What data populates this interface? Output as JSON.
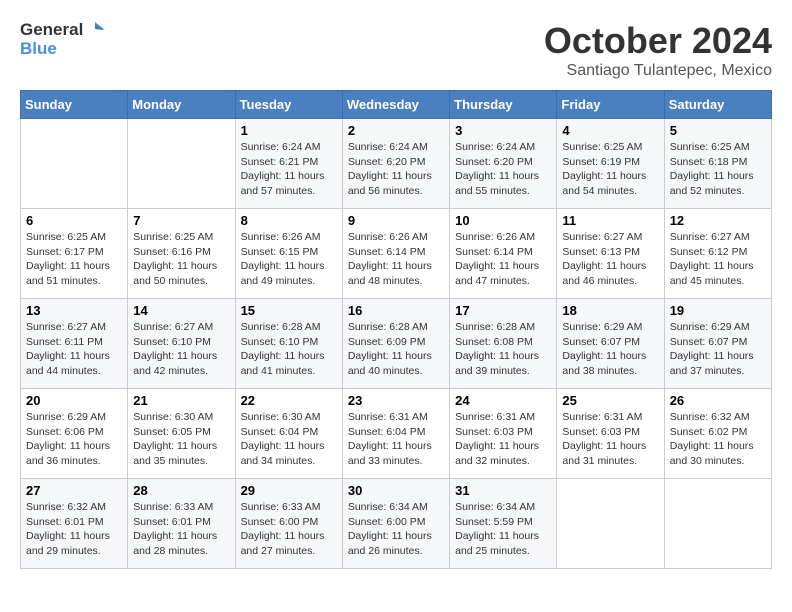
{
  "header": {
    "logo_line1": "General",
    "logo_line2": "Blue",
    "month": "October 2024",
    "location": "Santiago Tulantepec, Mexico"
  },
  "days_of_week": [
    "Sunday",
    "Monday",
    "Tuesday",
    "Wednesday",
    "Thursday",
    "Friday",
    "Saturday"
  ],
  "weeks": [
    [
      {
        "num": "",
        "sunrise": "",
        "sunset": "",
        "daylight": ""
      },
      {
        "num": "",
        "sunrise": "",
        "sunset": "",
        "daylight": ""
      },
      {
        "num": "1",
        "sunrise": "Sunrise: 6:24 AM",
        "sunset": "Sunset: 6:21 PM",
        "daylight": "Daylight: 11 hours and 57 minutes."
      },
      {
        "num": "2",
        "sunrise": "Sunrise: 6:24 AM",
        "sunset": "Sunset: 6:20 PM",
        "daylight": "Daylight: 11 hours and 56 minutes."
      },
      {
        "num": "3",
        "sunrise": "Sunrise: 6:24 AM",
        "sunset": "Sunset: 6:20 PM",
        "daylight": "Daylight: 11 hours and 55 minutes."
      },
      {
        "num": "4",
        "sunrise": "Sunrise: 6:25 AM",
        "sunset": "Sunset: 6:19 PM",
        "daylight": "Daylight: 11 hours and 54 minutes."
      },
      {
        "num": "5",
        "sunrise": "Sunrise: 6:25 AM",
        "sunset": "Sunset: 6:18 PM",
        "daylight": "Daylight: 11 hours and 52 minutes."
      }
    ],
    [
      {
        "num": "6",
        "sunrise": "Sunrise: 6:25 AM",
        "sunset": "Sunset: 6:17 PM",
        "daylight": "Daylight: 11 hours and 51 minutes."
      },
      {
        "num": "7",
        "sunrise": "Sunrise: 6:25 AM",
        "sunset": "Sunset: 6:16 PM",
        "daylight": "Daylight: 11 hours and 50 minutes."
      },
      {
        "num": "8",
        "sunrise": "Sunrise: 6:26 AM",
        "sunset": "Sunset: 6:15 PM",
        "daylight": "Daylight: 11 hours and 49 minutes."
      },
      {
        "num": "9",
        "sunrise": "Sunrise: 6:26 AM",
        "sunset": "Sunset: 6:14 PM",
        "daylight": "Daylight: 11 hours and 48 minutes."
      },
      {
        "num": "10",
        "sunrise": "Sunrise: 6:26 AM",
        "sunset": "Sunset: 6:14 PM",
        "daylight": "Daylight: 11 hours and 47 minutes."
      },
      {
        "num": "11",
        "sunrise": "Sunrise: 6:27 AM",
        "sunset": "Sunset: 6:13 PM",
        "daylight": "Daylight: 11 hours and 46 minutes."
      },
      {
        "num": "12",
        "sunrise": "Sunrise: 6:27 AM",
        "sunset": "Sunset: 6:12 PM",
        "daylight": "Daylight: 11 hours and 45 minutes."
      }
    ],
    [
      {
        "num": "13",
        "sunrise": "Sunrise: 6:27 AM",
        "sunset": "Sunset: 6:11 PM",
        "daylight": "Daylight: 11 hours and 44 minutes."
      },
      {
        "num": "14",
        "sunrise": "Sunrise: 6:27 AM",
        "sunset": "Sunset: 6:10 PM",
        "daylight": "Daylight: 11 hours and 42 minutes."
      },
      {
        "num": "15",
        "sunrise": "Sunrise: 6:28 AM",
        "sunset": "Sunset: 6:10 PM",
        "daylight": "Daylight: 11 hours and 41 minutes."
      },
      {
        "num": "16",
        "sunrise": "Sunrise: 6:28 AM",
        "sunset": "Sunset: 6:09 PM",
        "daylight": "Daylight: 11 hours and 40 minutes."
      },
      {
        "num": "17",
        "sunrise": "Sunrise: 6:28 AM",
        "sunset": "Sunset: 6:08 PM",
        "daylight": "Daylight: 11 hours and 39 minutes."
      },
      {
        "num": "18",
        "sunrise": "Sunrise: 6:29 AM",
        "sunset": "Sunset: 6:07 PM",
        "daylight": "Daylight: 11 hours and 38 minutes."
      },
      {
        "num": "19",
        "sunrise": "Sunrise: 6:29 AM",
        "sunset": "Sunset: 6:07 PM",
        "daylight": "Daylight: 11 hours and 37 minutes."
      }
    ],
    [
      {
        "num": "20",
        "sunrise": "Sunrise: 6:29 AM",
        "sunset": "Sunset: 6:06 PM",
        "daylight": "Daylight: 11 hours and 36 minutes."
      },
      {
        "num": "21",
        "sunrise": "Sunrise: 6:30 AM",
        "sunset": "Sunset: 6:05 PM",
        "daylight": "Daylight: 11 hours and 35 minutes."
      },
      {
        "num": "22",
        "sunrise": "Sunrise: 6:30 AM",
        "sunset": "Sunset: 6:04 PM",
        "daylight": "Daylight: 11 hours and 34 minutes."
      },
      {
        "num": "23",
        "sunrise": "Sunrise: 6:31 AM",
        "sunset": "Sunset: 6:04 PM",
        "daylight": "Daylight: 11 hours and 33 minutes."
      },
      {
        "num": "24",
        "sunrise": "Sunrise: 6:31 AM",
        "sunset": "Sunset: 6:03 PM",
        "daylight": "Daylight: 11 hours and 32 minutes."
      },
      {
        "num": "25",
        "sunrise": "Sunrise: 6:31 AM",
        "sunset": "Sunset: 6:03 PM",
        "daylight": "Daylight: 11 hours and 31 minutes."
      },
      {
        "num": "26",
        "sunrise": "Sunrise: 6:32 AM",
        "sunset": "Sunset: 6:02 PM",
        "daylight": "Daylight: 11 hours and 30 minutes."
      }
    ],
    [
      {
        "num": "27",
        "sunrise": "Sunrise: 6:32 AM",
        "sunset": "Sunset: 6:01 PM",
        "daylight": "Daylight: 11 hours and 29 minutes."
      },
      {
        "num": "28",
        "sunrise": "Sunrise: 6:33 AM",
        "sunset": "Sunset: 6:01 PM",
        "daylight": "Daylight: 11 hours and 28 minutes."
      },
      {
        "num": "29",
        "sunrise": "Sunrise: 6:33 AM",
        "sunset": "Sunset: 6:00 PM",
        "daylight": "Daylight: 11 hours and 27 minutes."
      },
      {
        "num": "30",
        "sunrise": "Sunrise: 6:34 AM",
        "sunset": "Sunset: 6:00 PM",
        "daylight": "Daylight: 11 hours and 26 minutes."
      },
      {
        "num": "31",
        "sunrise": "Sunrise: 6:34 AM",
        "sunset": "Sunset: 5:59 PM",
        "daylight": "Daylight: 11 hours and 25 minutes."
      },
      {
        "num": "",
        "sunrise": "",
        "sunset": "",
        "daylight": ""
      },
      {
        "num": "",
        "sunrise": "",
        "sunset": "",
        "daylight": ""
      }
    ]
  ]
}
